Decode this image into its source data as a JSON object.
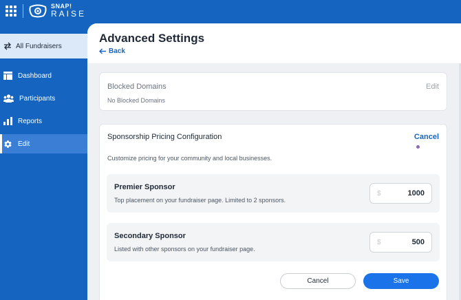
{
  "app": {
    "logo_line1": "SNAP!",
    "logo_line2": "RAISE",
    "apps_icon": "grid-icon"
  },
  "colors": {
    "brand": "#1565c0",
    "accent": "#1a73e8",
    "active_nav": "#3a7fd5"
  },
  "sidebar": {
    "switcher": {
      "label": "All Fundraisers",
      "icon": "swap-icon"
    },
    "items": [
      {
        "label": "Dashboard",
        "icon": "dashboard-icon",
        "active": false
      },
      {
        "label": "Participants",
        "icon": "participants-icon",
        "active": false
      },
      {
        "label": "Reports",
        "icon": "reports-icon",
        "active": false
      },
      {
        "label": "Edit",
        "icon": "gear-icon",
        "active": true
      }
    ]
  },
  "page": {
    "title": "Advanced Settings",
    "back_label": "Back"
  },
  "blocked_domains": {
    "title": "Blocked Domains",
    "edit_label": "Edit",
    "empty_text": "No Blocked Domains"
  },
  "sponsorship": {
    "title": "Sponsorship Pricing Configuration",
    "cancel_link": "Cancel",
    "description": "Customize pricing for your community and local businesses.",
    "tiers": [
      {
        "name": "Premier Sponsor",
        "description": "Top placement on your fundraiser page. Limited to 2 sponsors.",
        "currency": "$",
        "value": "1000"
      },
      {
        "name": "Secondary Sponsor",
        "description": "Listed with other sponsors on your fundraiser page.",
        "currency": "$",
        "value": "500"
      }
    ],
    "cancel_button": "Cancel",
    "save_button": "Save"
  }
}
